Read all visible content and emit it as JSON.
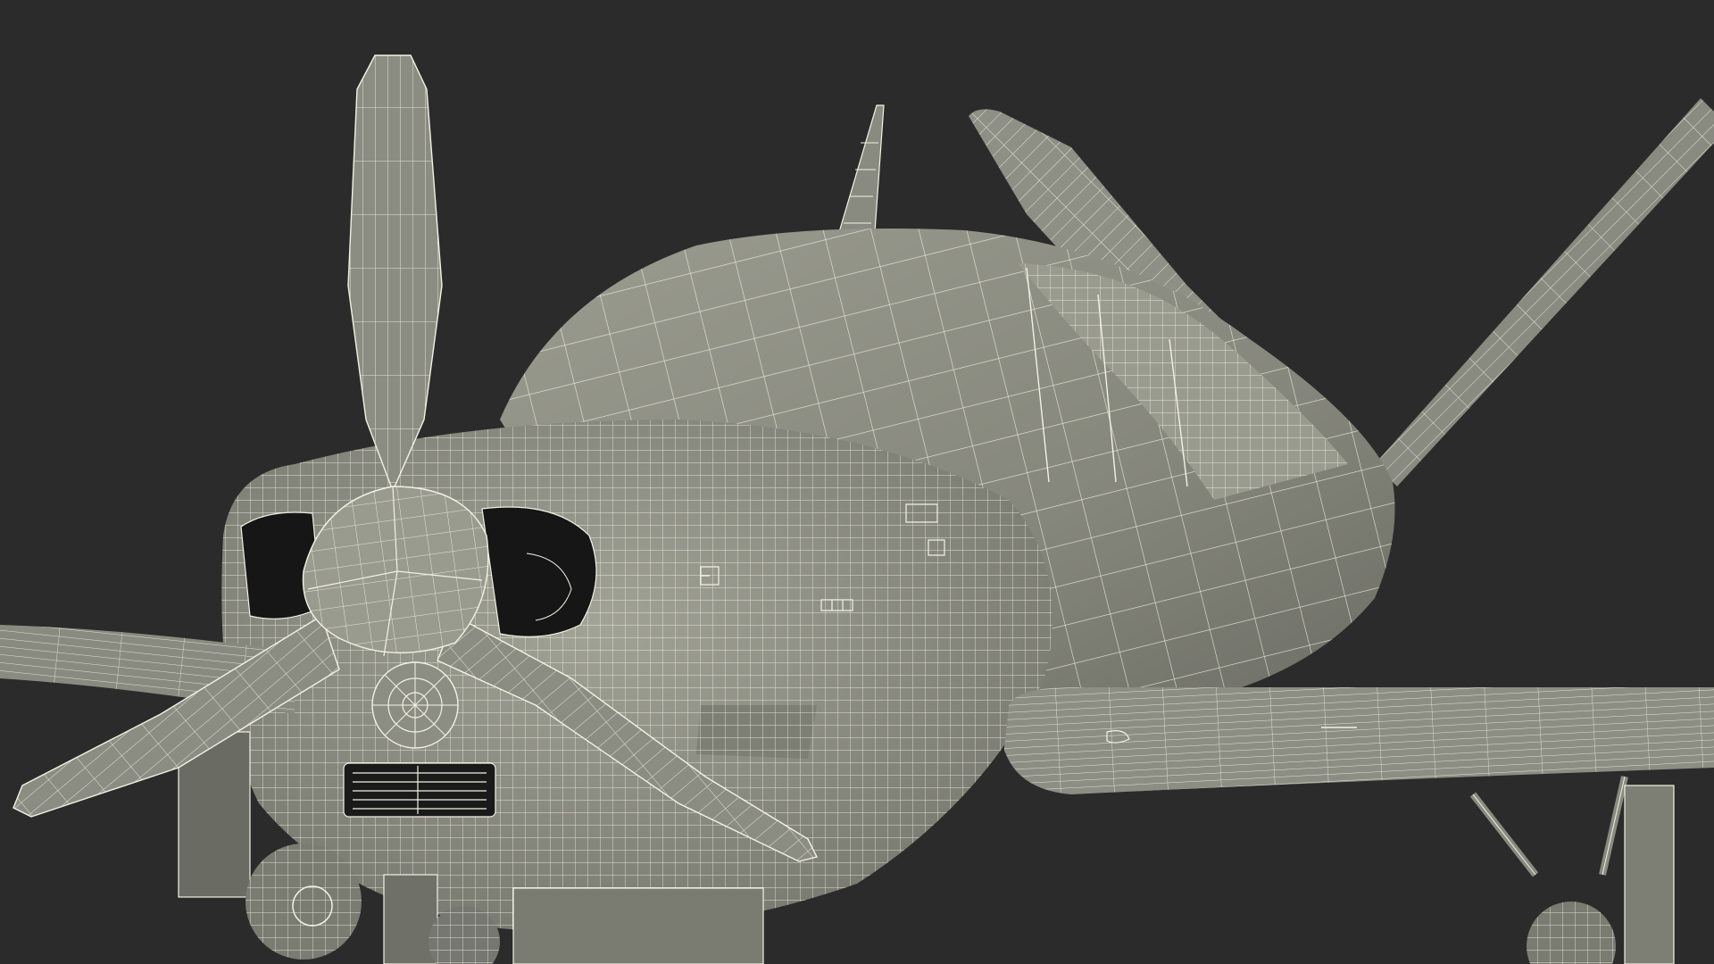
{
  "scene": {
    "subject": "airplane-wireframe-render",
    "colors": {
      "background": "#2b2b2b",
      "surface": "#8a8b80",
      "surface_light": "#a3a498",
      "surface_dark": "#5c5d55",
      "wire": "#f2f2e4",
      "cavity": "#161616"
    },
    "parts": [
      "propeller-spinner",
      "propeller-blade-top",
      "propeller-blade-left",
      "propeller-blade-right",
      "cowling",
      "air-intake-left",
      "air-intake-right",
      "fuselage",
      "canopy",
      "antenna",
      "vertical-stabilizer",
      "horizontal-stabilizer",
      "wing-left",
      "wing-right",
      "landing-gear-nose",
      "landing-gear-left",
      "landing-gear-right",
      "cooling-grille",
      "oil-cooler-vent"
    ]
  }
}
